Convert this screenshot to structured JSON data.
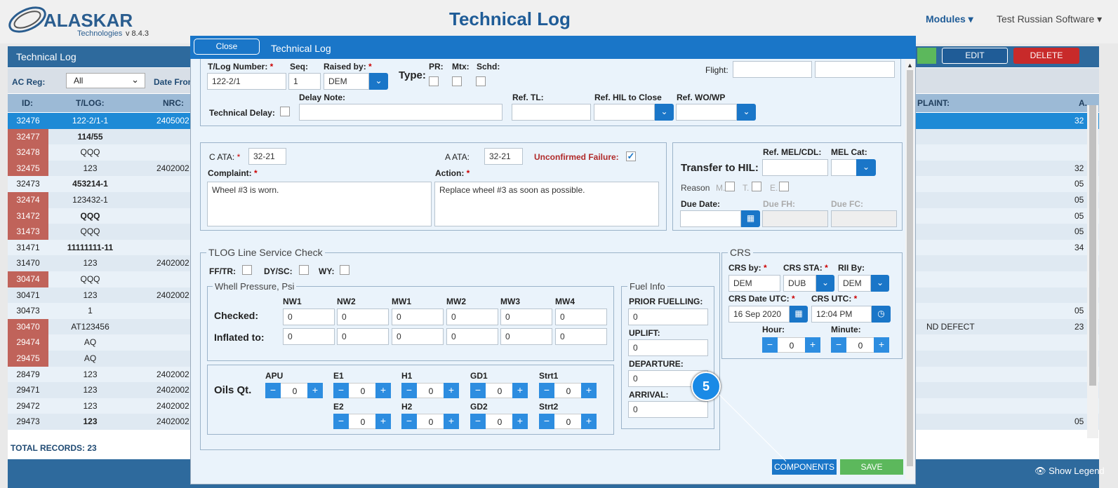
{
  "header": {
    "logo_text": "ALASKAR",
    "logo_sub": "Technologies",
    "version": "v 8.4.3",
    "title": "Technical Log",
    "modules": "Modules ▾",
    "user": "Test Russian Software ▾"
  },
  "background": {
    "panel_title": "Technical Log",
    "edit": "EDIT",
    "delete": "DELETE",
    "ac_reg_label": "AC Reg:",
    "ac_reg_value": "All",
    "date_from_label": "Date From",
    "columns": {
      "id": "ID:",
      "tlog": "T/LOG:",
      "nrc": "NRC:",
      "complaint": "PLAINT:",
      "a": "A."
    },
    "rows": [
      {
        "id": "32476",
        "tlog": "122-2/1-1",
        "nrc": "2405002",
        "a": "32",
        "selected": true,
        "red": false,
        "bold": false
      },
      {
        "id": "32477",
        "tlog": "114/55",
        "nrc": "",
        "a": "",
        "red": true,
        "bold": true
      },
      {
        "id": "32478",
        "tlog": "QQQ",
        "nrc": "",
        "a": "",
        "red": true,
        "bold": false
      },
      {
        "id": "32475",
        "tlog": "123",
        "nrc": "2402002",
        "a": "32",
        "red": true,
        "bold": false
      },
      {
        "id": "32473",
        "tlog": "453214-1",
        "nrc": "",
        "a": "05",
        "red": false,
        "bold": true
      },
      {
        "id": "32474",
        "tlog": "123432-1",
        "nrc": "",
        "a": "05",
        "red": true,
        "bold": false
      },
      {
        "id": "31472",
        "tlog": "QQQ",
        "nrc": "",
        "a": "05",
        "red": true,
        "bold": true
      },
      {
        "id": "31473",
        "tlog": "QQQ",
        "nrc": "",
        "a": "05",
        "red": true,
        "bold": false
      },
      {
        "id": "31471",
        "tlog": "11111111-11",
        "nrc": "",
        "a": "34",
        "red": false,
        "bold": true
      },
      {
        "id": "31470",
        "tlog": "123",
        "nrc": "2402002",
        "a": "",
        "red": false,
        "bold": false
      },
      {
        "id": "30474",
        "tlog": "QQQ",
        "nrc": "",
        "a": "",
        "red": true,
        "bold": false
      },
      {
        "id": "30471",
        "tlog": "123",
        "nrc": "2402002",
        "a": "",
        "red": false,
        "bold": false
      },
      {
        "id": "30473",
        "tlog": "1",
        "nrc": "",
        "a": "05",
        "red": false,
        "bold": false
      },
      {
        "id": "30470",
        "tlog": "AT123456",
        "nrc": "",
        "a": "23",
        "complaint": "ND DEFECT",
        "red": true,
        "bold": false
      },
      {
        "id": "29474",
        "tlog": "AQ",
        "nrc": "",
        "a": "",
        "red": true,
        "bold": false
      },
      {
        "id": "29475",
        "tlog": "AQ",
        "nrc": "",
        "a": "",
        "red": true,
        "bold": false
      },
      {
        "id": "28479",
        "tlog": "123",
        "nrc": "2402002",
        "a": "",
        "red": false,
        "bold": false
      },
      {
        "id": "29471",
        "tlog": "123",
        "nrc": "2402002",
        "a": "",
        "red": false,
        "bold": false
      },
      {
        "id": "29472",
        "tlog": "123",
        "nrc": "2402002",
        "a": "",
        "red": false,
        "bold": false
      },
      {
        "id": "29473",
        "tlog": "123",
        "nrc": "2402002",
        "a": "05",
        "red": false,
        "bold": true
      }
    ],
    "total": "TOTAL RECORDS: 23",
    "show_legend": "Show Legend"
  },
  "modal": {
    "close": "Close",
    "title": "Technical Log",
    "tlog_number_label": "T/Log Number:",
    "tlog_number": "122-2/1",
    "seq_label": "Seq:",
    "seq": "1",
    "raised_by_label": "Raised by:",
    "raised_by": "DEM",
    "type_label": "Type:",
    "pr_label": "PR:",
    "mtx_label": "Mtx:",
    "schd_label": "Schd:",
    "flight_label": "Flight:",
    "delay_note_label": "Delay Note:",
    "technical_delay_label": "Technical Delay:",
    "ref_tl_label": "Ref. TL:",
    "ref_hil_label": "Ref. HIL to Close",
    "ref_wo_label": "Ref. WO/WP",
    "c_ata_label": "C ATA:",
    "c_ata": "32-21",
    "a_ata_label": "A ATA:",
    "a_ata": "32-21",
    "unconfirmed_label": "Unconfirmed Failure:",
    "complaint_label": "Complaint:",
    "complaint": "Wheel #3 is worn.",
    "action_label": "Action:",
    "action": "Replace wheel #3 as soon as possible.",
    "transfer_hil_label": "Transfer to HIL:",
    "ref_mel_label": "Ref. MEL/CDL:",
    "mel_cat_label": "MEL Cat:",
    "reason_label": "Reason",
    "reason_m": "M.",
    "reason_t": "T.",
    "reason_e": "E.",
    "due_date_label": "Due Date:",
    "due_fh_label": "Due FH:",
    "due_fc_label": "Due FC:",
    "line_check_legend": "TLOG Line Service Check",
    "fftr_label": "FF/TR:",
    "dysc_label": "DY/SC:",
    "wy_label": "WY:",
    "wheel_legend": "Whell Pressure, Psi",
    "wheel_cols": [
      "NW1",
      "NW2",
      "MW1",
      "MW2",
      "MW3",
      "MW4"
    ],
    "checked_label": "Checked:",
    "checked_values": [
      "0",
      "0",
      "0",
      "0",
      "0",
      "0"
    ],
    "inflated_label": "Inflated to:",
    "inflated_values": [
      "0",
      "0",
      "0",
      "0",
      "0",
      "0"
    ],
    "oils_label": "Oils Qt.",
    "oils_top": [
      {
        "label": "APU",
        "value": "0"
      },
      {
        "label": "E1",
        "value": "0"
      },
      {
        "label": "H1",
        "value": "0"
      },
      {
        "label": "GD1",
        "value": "0"
      },
      {
        "label": "Strt1",
        "value": "0"
      }
    ],
    "oils_bottom": [
      {
        "label": "E2",
        "value": "0"
      },
      {
        "label": "H2",
        "value": "0"
      },
      {
        "label": "GD2",
        "value": "0"
      },
      {
        "label": "Strt2",
        "value": "0"
      }
    ],
    "fuel_legend": "Fuel Info",
    "prior_fuelling_label": "PRIOR FUELLING:",
    "prior_fuelling": "0",
    "uplift_label": "UPLIFT:",
    "uplift": "0",
    "departure_label": "DEPARTURE:",
    "departure": "0",
    "arrival_label": "ARRIVAL:",
    "arrival": "0",
    "crs_legend": "CRS",
    "crs_by_label": "CRS by:",
    "crs_by": "DEM",
    "crs_sta_label": "CRS STA:",
    "crs_sta": "DUB",
    "rii_by_label": "RII By:",
    "rii_by": "DEM",
    "crs_date_label": "CRS Date UTC:",
    "crs_date": "16 Sep 2020",
    "crs_utc_label": "CRS UTC:",
    "crs_utc": "12:04 PM",
    "hour_label": "Hour:",
    "hour": "0",
    "minute_label": "Minute:",
    "minute": "0",
    "components": "COMPONENTS",
    "save": "SAVE",
    "callout": "5"
  },
  "colors": {
    "primary": "#1a76c8",
    "danger": "#c82a2a",
    "success": "#5cb85c",
    "header": "#2e6a9d"
  }
}
